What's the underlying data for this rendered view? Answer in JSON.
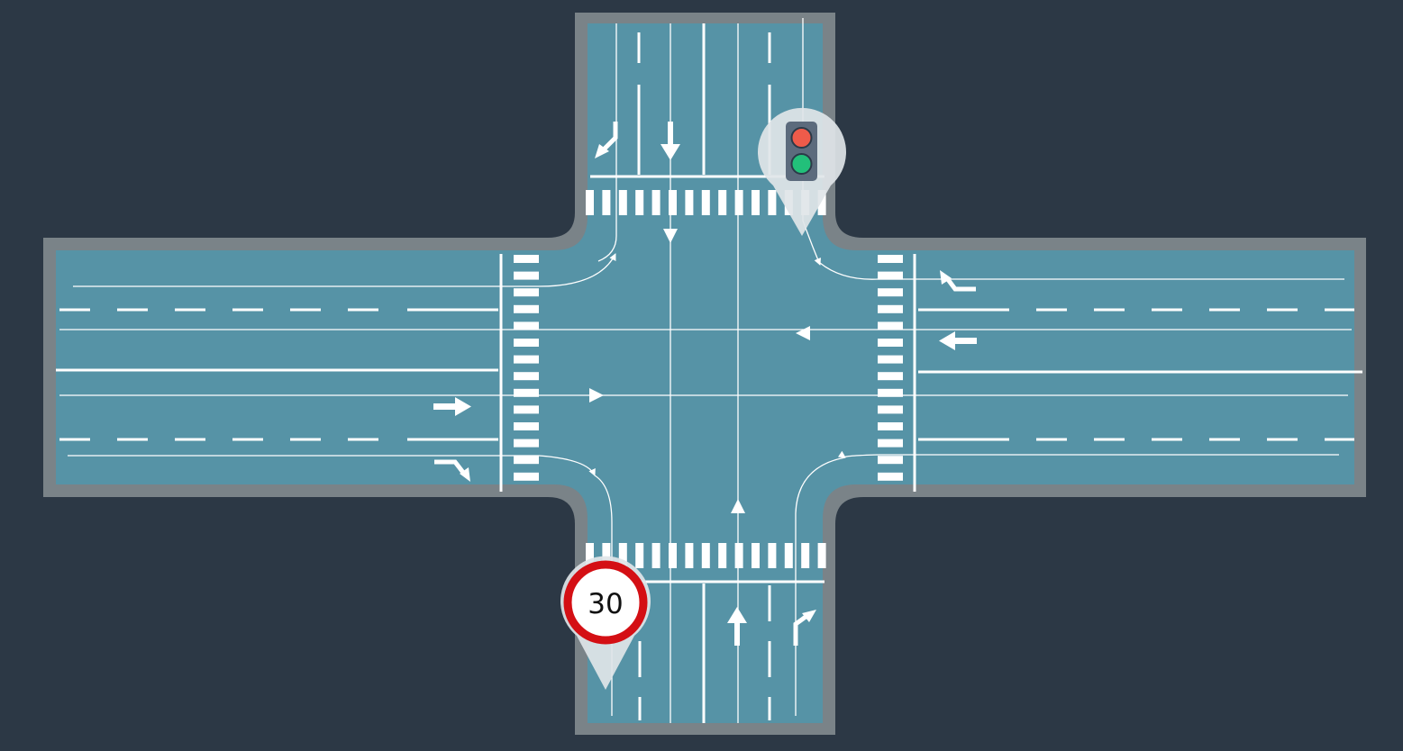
{
  "colors": {
    "background": "#2c3845",
    "road_border": "#7a8388",
    "road_surface": "#5693a6",
    "marking": "#ffffff",
    "light_red": "#ef5b4a",
    "light_green": "#22c07a",
    "light_housing": "#5c6b7d",
    "pin": "#dfe5e8",
    "sign_ring": "#d40f14"
  },
  "speed_limit_sign": {
    "value": "30",
    "icon": "speed-limit-sign-icon"
  },
  "traffic_light_marker": {
    "icon": "traffic-light-icon",
    "lamps": [
      "red",
      "green"
    ]
  },
  "lane_arrows": {
    "north_approach": [
      "left-turn-arrow-icon",
      "straight-arrow-icon"
    ],
    "south_approach": [
      "straight-arrow-icon",
      "right-turn-arrow-icon"
    ],
    "west_approach": [
      "straight-arrow-icon",
      "right-turn-arrow-icon"
    ],
    "east_approach": [
      "right-turn-arrow-icon",
      "straight-arrow-icon"
    ]
  }
}
